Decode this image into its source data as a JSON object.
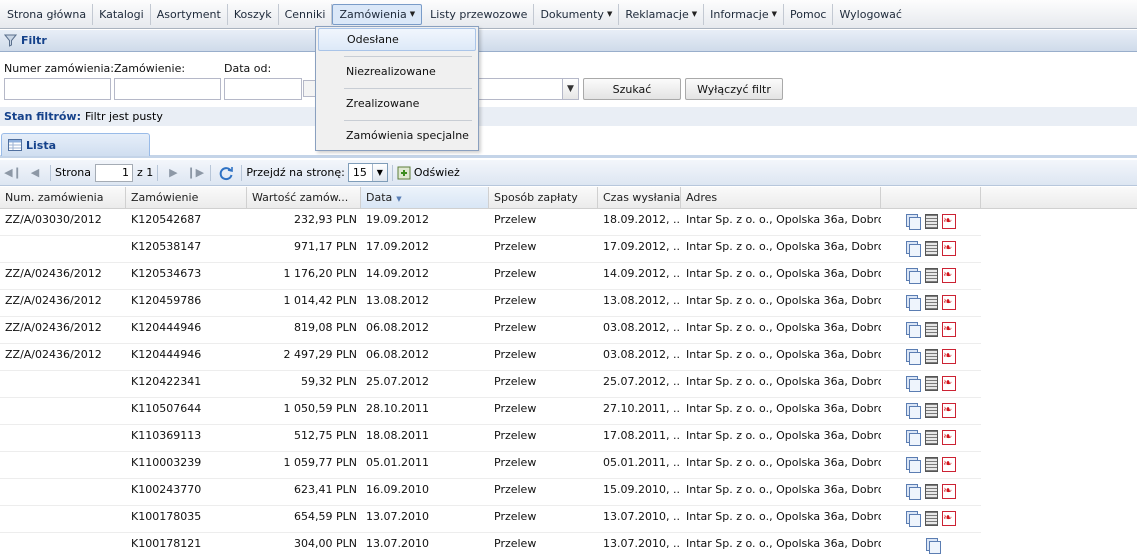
{
  "menu": [
    {
      "label": "Strona główna",
      "caret": false
    },
    {
      "label": "Katalogi",
      "caret": false
    },
    {
      "label": "Asortyment",
      "caret": false
    },
    {
      "label": "Koszyk",
      "caret": false
    },
    {
      "label": "Cenniki",
      "caret": false
    },
    {
      "label": "Zamówienia",
      "caret": true,
      "active": true
    },
    {
      "label": "Listy przewozowe",
      "caret": false
    },
    {
      "label": "Dokumenty",
      "caret": true
    },
    {
      "label": "Reklamacje",
      "caret": true
    },
    {
      "label": "Informacje",
      "caret": true
    },
    {
      "label": "Pomoc",
      "caret": false
    },
    {
      "label": "Wylogować",
      "caret": false
    }
  ],
  "dropdown": [
    "Odesłane",
    "Niezrealizowane",
    "Zrealizowane",
    "Zamówienia specjalne"
  ],
  "filter": {
    "title": "Filtr",
    "labels": {
      "order_number": "Numer zamówienia:",
      "order": "Zamówienie:",
      "date_from": "Data od:"
    },
    "search_button": "Szukać",
    "clear_button": "Wyłączyć filtr",
    "state_label": "Stan filtrów:",
    "state_value": "Filtr jest pusty"
  },
  "list_tab": "Lista",
  "pager": {
    "page_label": "Strona",
    "page_value": "1",
    "of_label": "z 1",
    "goto_label": "Przejdź na stronę:",
    "page_size": "15",
    "refresh_label": "Odśwież"
  },
  "columns": [
    "Num. zamówienia",
    "Zamówienie",
    "Wartość zamów...",
    "Data",
    "Sposób zapłaty",
    "Czas wysłania",
    "Adres",
    ""
  ],
  "rows": [
    [
      "ZZ/A/03030/2012",
      "K120542687",
      "232,93 PLN",
      "19.09.2012",
      "Przelew",
      "18.09.2012, ...",
      "Intar Sp. z o. o., Opolska 36a, Dobro..."
    ],
    [
      "",
      "K120538147",
      "971,17 PLN",
      "17.09.2012",
      "Przelew",
      "17.09.2012, ...",
      "Intar Sp. z o. o., Opolska 36a, Dobro..."
    ],
    [
      "ZZ/A/02436/2012",
      "K120534673",
      "1 176,20 PLN",
      "14.09.2012",
      "Przelew",
      "14.09.2012, ...",
      "Intar Sp. z o. o., Opolska 36a, Dobro..."
    ],
    [
      "ZZ/A/02436/2012",
      "K120459786",
      "1 014,42 PLN",
      "13.08.2012",
      "Przelew",
      "13.08.2012, ...",
      "Intar Sp. z o. o., Opolska 36a, Dobro..."
    ],
    [
      "ZZ/A/02436/2012",
      "K120444946",
      "819,08 PLN",
      "06.08.2012",
      "Przelew",
      "03.08.2012, ...",
      "Intar Sp. z o. o., Opolska 36a, Dobro..."
    ],
    [
      "ZZ/A/02436/2012",
      "K120444946",
      "2 497,29 PLN",
      "06.08.2012",
      "Przelew",
      "03.08.2012, ...",
      "Intar Sp. z o. o., Opolska 36a, Dobro..."
    ],
    [
      "",
      "K120422341",
      "59,32 PLN",
      "25.07.2012",
      "Przelew",
      "25.07.2012, ...",
      "Intar Sp. z o. o., Opolska 36a, Dobro..."
    ],
    [
      "",
      "K110507644",
      "1 050,59 PLN",
      "28.10.2011",
      "Przelew",
      "27.10.2011, ...",
      "Intar Sp. z o. o., Opolska 36a, Dobro..."
    ],
    [
      "",
      "K110369113",
      "512,75 PLN",
      "18.08.2011",
      "Przelew",
      "17.08.2011, ...",
      "Intar Sp. z o. o., Opolska 36a, Dobro..."
    ],
    [
      "",
      "K110003239",
      "1 059,77 PLN",
      "05.01.2011",
      "Przelew",
      "05.01.2011, ...",
      "Intar Sp. z o. o., Opolska 36a, Dobro..."
    ],
    [
      "",
      "K100243770",
      "623,41 PLN",
      "16.09.2010",
      "Przelew",
      "15.09.2010, ...",
      "Intar Sp. z o. o., Opolska 36a, Dobro..."
    ],
    [
      "",
      "K100178035",
      "654,59 PLN",
      "13.07.2010",
      "Przelew",
      "13.07.2010, ...",
      "Intar Sp. z o. o., Opolska 36a, Dobro..."
    ],
    [
      "",
      "K100178121",
      "304,00 PLN",
      "13.07.2010",
      "Przelew",
      "13.07.2010, ...",
      "Intar Sp. z o. o., Opolska 36a, Dobro..."
    ]
  ],
  "colors": {
    "header_blue": "#15428b",
    "pdf_red": "#d1121a"
  }
}
